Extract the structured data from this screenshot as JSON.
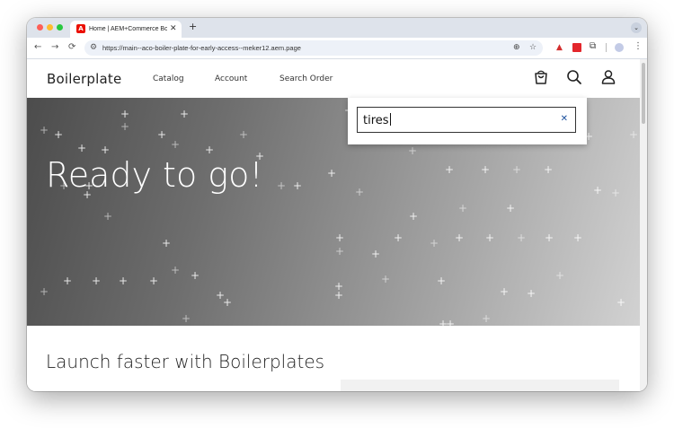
{
  "browser": {
    "tab": {
      "favicon": "A",
      "title": "Home | AEM+Commerce Boilerplate",
      "close_glyph": "✕"
    },
    "new_tab_glyph": "+",
    "tab_menu_glyph": "⌄",
    "nav": {
      "back": "←",
      "forward": "→",
      "reload": "⟳"
    },
    "omnibox": {
      "url": "https://main--aco-boiler-plate-for-early-access--meker12.aem.page",
      "site_icon": "site-settings-icon",
      "zoom_glyph": "⊕",
      "bookmark_glyph": "☆"
    },
    "extensions": [
      "adobe-extension-icon",
      "red-extension-icon",
      "puzzle-icon",
      "profile-avatar-icon",
      "kebab-menu-icon"
    ],
    "colors": {
      "tabstrip": "#dee3eb",
      "omnibox": "#edf1f8",
      "adobe_red": "#eb1000"
    }
  },
  "site": {
    "logo": "Boilerplate",
    "nav": [
      {
        "label": "Catalog"
      },
      {
        "label": "Account"
      },
      {
        "label": "Search Order"
      }
    ],
    "icons": [
      "cart-icon",
      "search-icon",
      "user-icon"
    ],
    "search": {
      "value": "tires",
      "clear_glyph": "✕"
    },
    "hero": {
      "title": "Ready to go!"
    },
    "section": {
      "title": "Launch faster with Boilerplates"
    },
    "colors": {
      "clear_icon": "#1a4f9c",
      "text": "#222222"
    }
  }
}
